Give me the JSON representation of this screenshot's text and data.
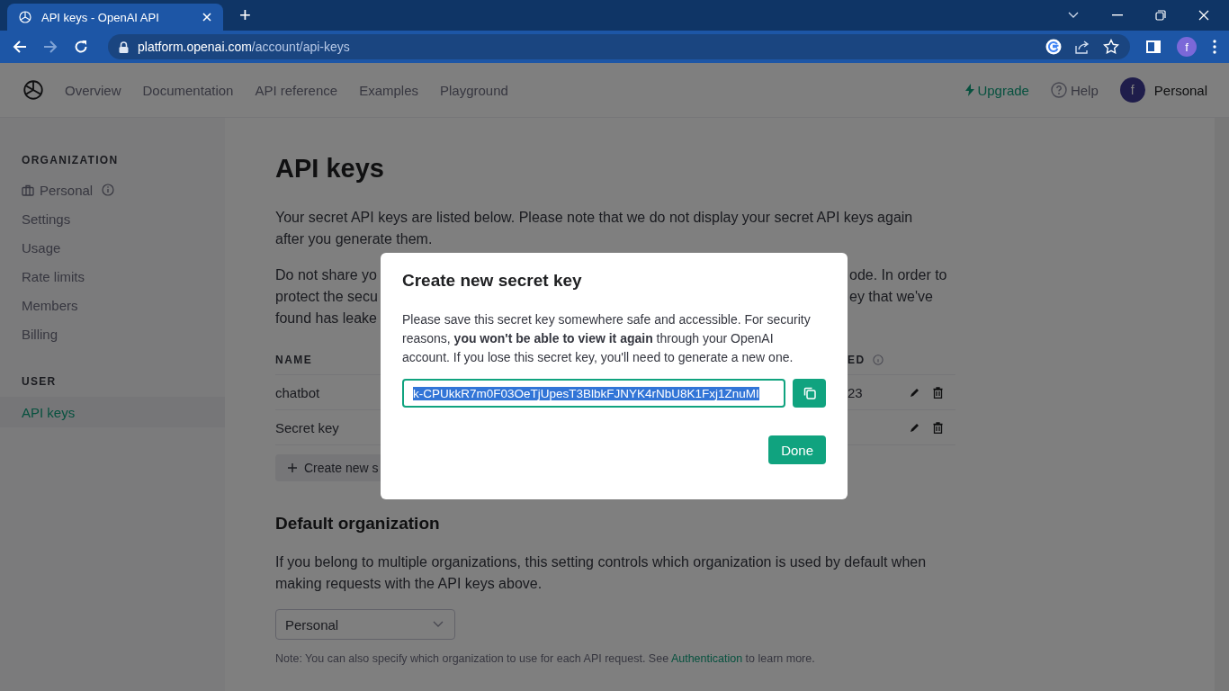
{
  "browser": {
    "tabs": [
      {
        "title": "API keys - OpenAI API",
        "selected": true
      }
    ],
    "new_tab": "+",
    "nav": [
      {
        "kind": "back",
        "disabled": false
      },
      {
        "kind": "forward",
        "disabled": true
      },
      {
        "kind": "reload",
        "disabled": false
      }
    ],
    "url_host": "platform.openai.com",
    "url_path": "/account/api-keys",
    "profile": "f"
  },
  "header": {
    "nav": [
      "Overview",
      "Documentation",
      "API reference",
      "Examples",
      "Playground"
    ],
    "upgrade": "Upgrade",
    "help": "Help",
    "avatar": "f",
    "account": "Personal"
  },
  "sidebar": {
    "sections": [
      {
        "heading": "ORGANIZATION",
        "items": [
          {
            "label": "Personal",
            "kind": "org",
            "selected": false
          },
          {
            "label": "Settings",
            "kind": "link",
            "selected": false
          },
          {
            "label": "Usage",
            "kind": "link",
            "selected": false
          },
          {
            "label": "Rate limits",
            "kind": "link",
            "selected": false
          },
          {
            "label": "Members",
            "kind": "link",
            "selected": false
          },
          {
            "label": "Billing",
            "kind": "link",
            "selected": false
          }
        ]
      },
      {
        "heading": "USER",
        "items": [
          {
            "label": "API keys",
            "kind": "link",
            "selected": true
          }
        ]
      }
    ]
  },
  "main": {
    "title": "API keys",
    "intro": "Your secret API keys are listed below. Please note that we do not display your secret API keys again after you generate them.",
    "warning_lines": [
      {
        "left": "Do not share yo",
        "right": "ode. In order to"
      },
      {
        "left": "protect the secu",
        "right": "ey that we've"
      },
      {
        "left": "found has leake"
      }
    ],
    "table": {
      "columns": [
        "NAME",
        "ED"
      ],
      "rows": [
        {
          "name": "chatbot",
          "column_2": "23"
        },
        {
          "name": "Secret key"
        }
      ]
    },
    "create_button": "Create new s",
    "default_org": {
      "heading": "Default organization",
      "text": "If you belong to multiple organizations, this setting controls which organization is used by default when making requests with the API keys above.",
      "select": "Personal",
      "note_before": "Note: You can also specify which organization to use for each API request. See ",
      "note_link": "Authentication",
      "note_after": " to learn more."
    }
  },
  "modal": {
    "title": "Create new secret key",
    "body": "Please save this secret key somewhere safe and accessible. For security reasons, **you won't be able to view it again** through your OpenAI account. If you lose this secret key, you'll need to generate a new one.",
    "key": "k-CPUkkR7m0F03OeTjUpesT3BlbkFJNYK4rNbU8K1Fxj1ZnuMI",
    "done": "Done"
  }
}
